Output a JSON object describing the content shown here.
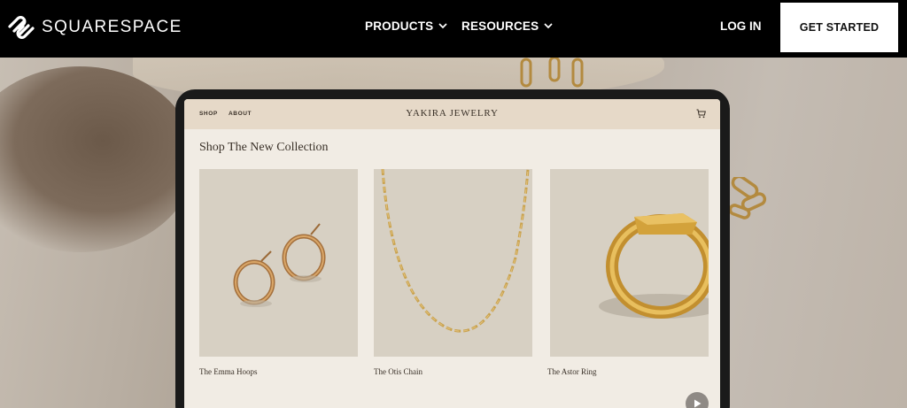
{
  "brand": {
    "name": "SQUARESPACE",
    "logo_icon": "squarespace-logo-icon"
  },
  "nav": {
    "items": [
      {
        "label": "PRODUCTS",
        "icon": "chevron-down-icon"
      },
      {
        "label": "RESOURCES",
        "icon": "chevron-down-icon"
      }
    ],
    "login": "LOG IN",
    "cta": "GET STARTED"
  },
  "preview": {
    "site_nav": [
      "SHOP",
      "ABOUT"
    ],
    "site_title": "YAKIRA JEWELRY",
    "cart_icon": "cart-icon",
    "collection_title": "Shop The New Collection",
    "products": [
      {
        "name": "The Emma Hoops"
      },
      {
        "name": "The Otis Chain"
      },
      {
        "name": "The Astor Ring"
      }
    ],
    "play_icon": "play-icon"
  },
  "colors": {
    "nav_bg": "#000000",
    "cta_bg": "#ffffff",
    "site_header_bg": "#e6d9c8",
    "site_bg": "#f1ece4",
    "product_bg": "#d7d0c3",
    "gold": "#c9a24e"
  }
}
